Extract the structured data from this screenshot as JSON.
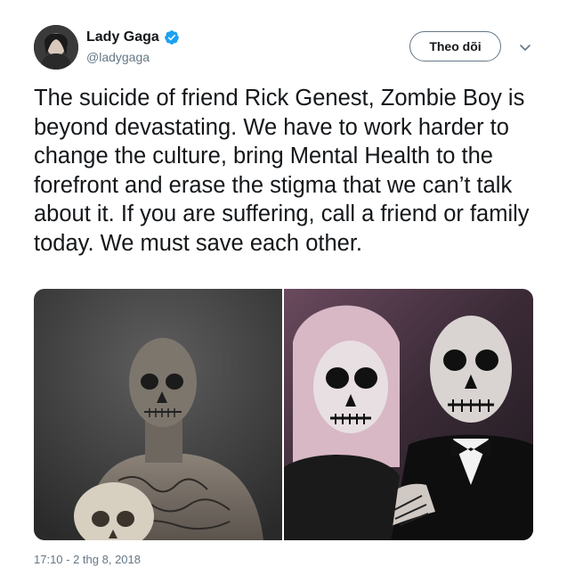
{
  "user": {
    "display_name": "Lady Gaga",
    "handle": "@ladygaga",
    "verified": true,
    "avatar_icon": "avatar-photo"
  },
  "actions": {
    "follow_label": "Theo dõi",
    "menu_icon": "chevron-down-icon"
  },
  "tweet": {
    "text": "The suicide of friend Rick Genest, Zombie Boy is beyond devastating. We have to work harder to change the culture, bring Mental Health to the forefront and erase the stigma that we can’t talk about it. If you are suffering, call a friend or family today. We must save each other.",
    "timestamp": "17:10 - 2 thg 8, 2018"
  },
  "media": {
    "count": 2,
    "items": [
      "photo-skull-tattoo-man",
      "photo-skeleton-makeup-couple"
    ]
  },
  "colors": {
    "text": "#14171a",
    "secondary": "#657786",
    "verified": "#1da1f2",
    "border": "#657786"
  }
}
